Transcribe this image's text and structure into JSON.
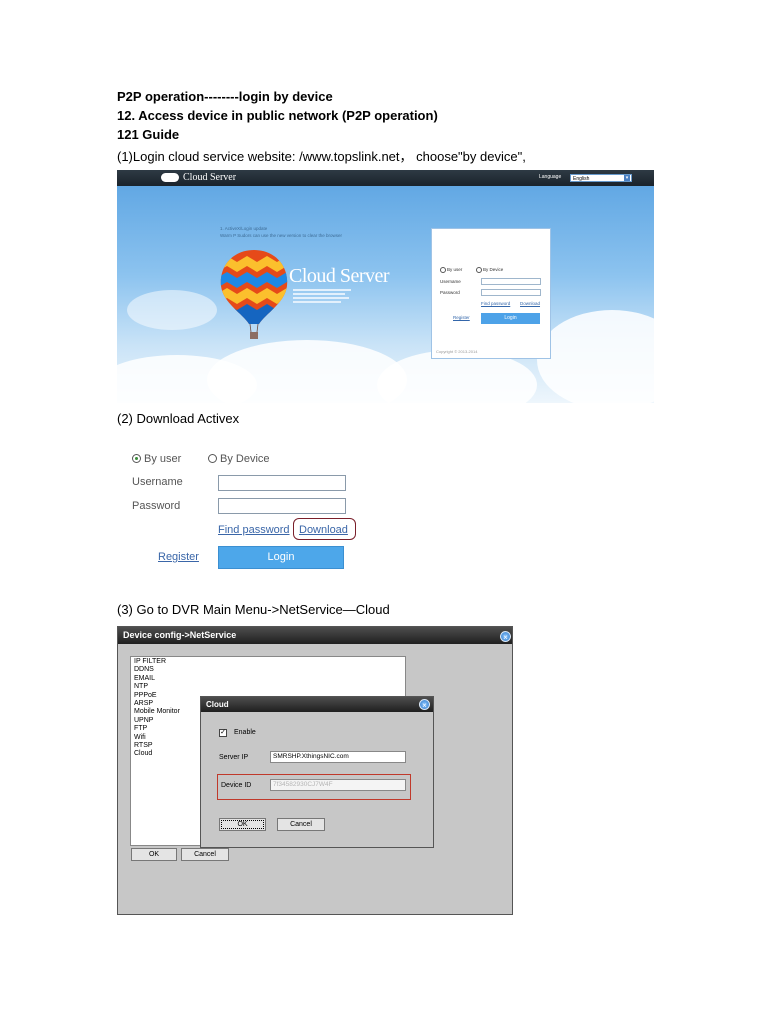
{
  "doc": {
    "heading1": "P2P operation--------login by device",
    "heading2": "12. Access device in public network (P2P operation)",
    "heading3": "121 Guide",
    "step1": "(1)Login cloud service website: /www.topslink.net， choose\"by device\",",
    "step2": "(2) Download Activex",
    "step3": "(3) Go to DVR Main Menu->NetService—Cloud"
  },
  "fig1": {
    "brand": "Cloud Server",
    "language_label": "Language",
    "language_value": "English",
    "notice": [
      "1. ActiveX/Login update",
      "Warm P Sudors can use the new version to clear the browser"
    ],
    "big_title": "Cloud Server",
    "login": {
      "by_user": "By user",
      "by_device": "By Device",
      "username": "Username",
      "password": "Password",
      "find_password": "Find password",
      "download": "Download",
      "register": "Register",
      "login_btn": "Login",
      "copyright": "Copyright © 2013-2014"
    }
  },
  "fig2": {
    "by_user": "By user",
    "by_device": "By Device",
    "username_label": "Username",
    "password_label": "Password",
    "find_password": "Find password",
    "download": "Download",
    "register": "Register",
    "login_btn": "Login"
  },
  "fig3": {
    "title": "Device config->NetService",
    "services": [
      "IP FILTER",
      "DDNS",
      "EMAIL",
      "NTP",
      "PPPoE",
      "ARSP",
      "Mobile Monitor",
      "UPNP",
      "FTP",
      "Wifi",
      "RTSP",
      "Cloud"
    ],
    "ok": "OK",
    "cancel": "Cancel",
    "cloud_dialog": {
      "title": "Cloud",
      "enable_label": "Enable",
      "enable_checked": true,
      "server_ip_label": "Server IP",
      "server_ip_value": "SMRSHP.XthingsNIC.com",
      "device_id_label": "Device ID",
      "device_id_value": "7f34582930CJ7W4F",
      "ok": "OK",
      "cancel": "Cancel"
    }
  }
}
